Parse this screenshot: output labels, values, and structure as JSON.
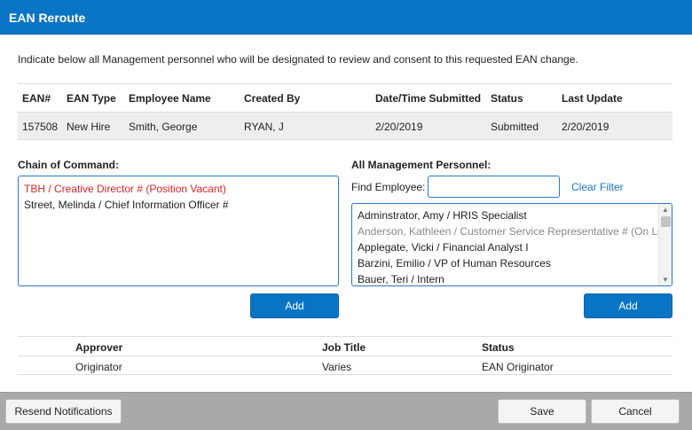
{
  "dialog": {
    "title": "EAN Reroute"
  },
  "instructions": "Indicate below all Management personnel who will be designated to review and consent to this requested EAN change.",
  "ean_table": {
    "headers": [
      "EAN#",
      "EAN Type",
      "Employee Name",
      "Created By",
      "Date/Time Submitted",
      "Status",
      "Last Update"
    ],
    "row": [
      "157508",
      "New Hire",
      "Smith, George",
      "RYAN, J",
      "2/20/2019",
      "Submitted",
      "2/20/2019"
    ]
  },
  "chain_of_command": {
    "label": "Chain of Command:",
    "items": [
      {
        "text": "TBH / Creative Director # (Position Vacant)",
        "style": "red"
      },
      {
        "text": "Street, Melinda / Chief Information Officer #",
        "style": "normal"
      }
    ],
    "add_label": "Add"
  },
  "management": {
    "label": "All Management Personnel:",
    "find_label": "Find Employee:",
    "find_value": "",
    "clear_filter_label": "Clear Filter",
    "items": [
      {
        "text": "Adminstrator, Amy / HRIS Specialist",
        "style": "normal"
      },
      {
        "text": "Anderson, Kathleen / Customer Service Representative # (On Leave)",
        "style": "grey"
      },
      {
        "text": "Applegate, Vicki / Financial Analyst I",
        "style": "normal"
      },
      {
        "text": "Barzini, Emilio / VP of Human Resources",
        "style": "normal"
      },
      {
        "text": "Bauer, Teri / Intern",
        "style": "normal"
      }
    ],
    "add_label": "Add"
  },
  "approver_table": {
    "headers": [
      "Approver",
      "Job Title",
      "Status"
    ],
    "rows": [
      [
        "Originator",
        "Varies",
        "EAN Originator"
      ]
    ]
  },
  "footer": {
    "resend_label": "Resend Notifications",
    "save_label": "Save",
    "cancel_label": "Cancel"
  }
}
